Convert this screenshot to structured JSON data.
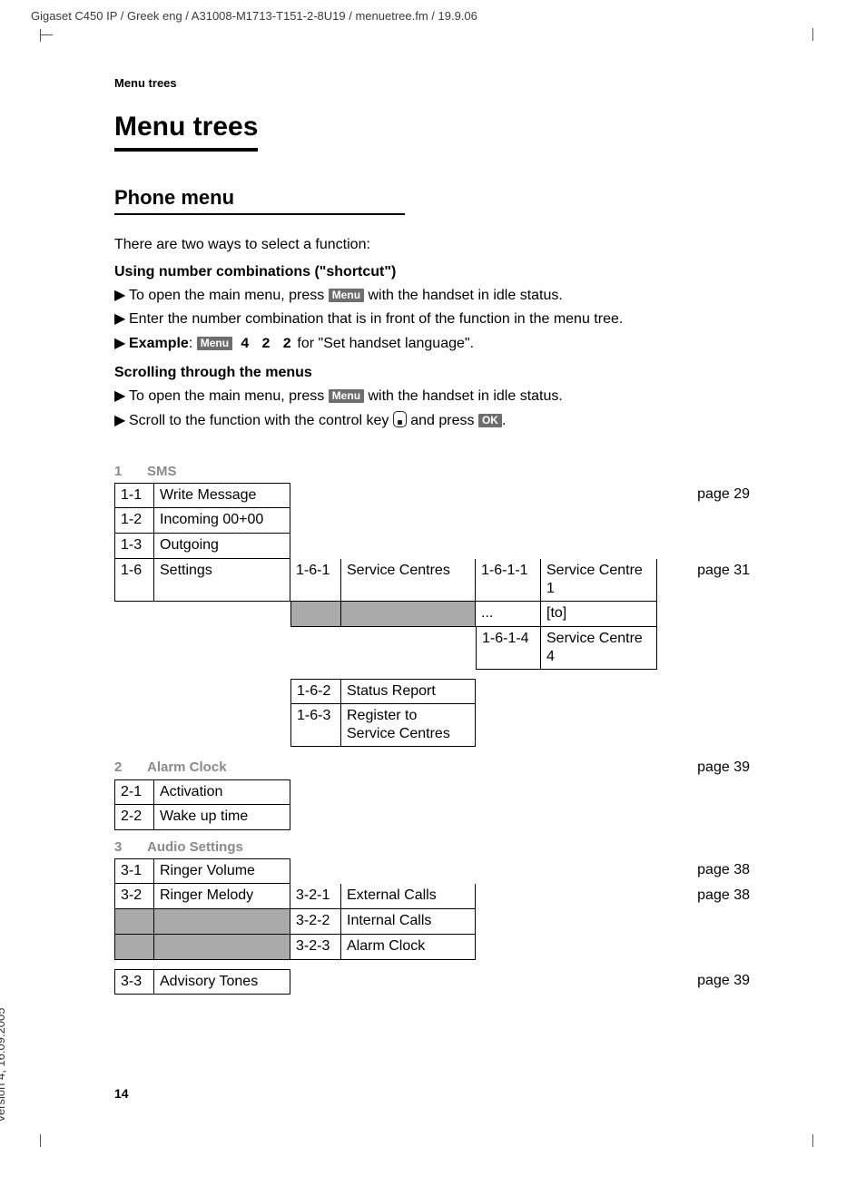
{
  "header_line": "Gigaset C450 IP / Greek eng / A31008-M1713-T151-2-8U19 / menuetree.fm / 19.9.06",
  "running_head": "Menu trees",
  "title": "Menu trees",
  "subtitle": "Phone menu",
  "intro": "There are two ways to select a function:",
  "section1": {
    "head": "Using number combinations (\"shortcut\")",
    "b1a": "To open the main menu, press ",
    "menu_key": "Menu",
    "b1b": " with the handset in idle status.",
    "b2": "Enter the number combination that is in front of the function in the menu tree.",
    "b3_label": "Example",
    "b3_code": "4 2 2",
    "b3_tail": " for \"Set handset language\"."
  },
  "section2": {
    "head": "Scrolling through the menus",
    "b1a": "To open the main menu, press ",
    "menu_key": "Menu",
    "b1b": " with the handset in idle status.",
    "b2a": "Scroll to the function with the control key ",
    "b2b": " and press ",
    "ok_key": "OK",
    "b2c": "."
  },
  "tree": {
    "s1": {
      "num": "1",
      "title": "SMS"
    },
    "s1_rows": [
      {
        "code": "1-1",
        "name": "Write Message",
        "page": "page 29"
      },
      {
        "code": "1-2",
        "name": "Incoming 00+00"
      },
      {
        "code": "1-3",
        "name": "Outgoing"
      },
      {
        "code": "1-6",
        "name": "Settings",
        "l2": [
          {
            "code": "1-6-1",
            "name": "Service Centres",
            "l3": [
              {
                "code": "1-6-1-1",
                "name": "Service Centre 1",
                "page": "page 31"
              },
              {
                "code": "...",
                "name": "[to]"
              },
              {
                "code": "1-6-1-4",
                "name": "Service Centre 4"
              }
            ]
          },
          {
            "code": "1-6-2",
            "name": "Status Report"
          },
          {
            "code": "1-6-3",
            "name": "Register to Service Centres"
          }
        ]
      }
    ],
    "s2": {
      "num": "2",
      "title": "Alarm Clock",
      "page": "page 39"
    },
    "s2_rows": [
      {
        "code": "2-1",
        "name": "Activation"
      },
      {
        "code": "2-2",
        "name": "Wake up time"
      }
    ],
    "s3": {
      "num": "3",
      "title": "Audio Settings"
    },
    "s3_rows": [
      {
        "code": "3-1",
        "name": "Ringer Volume",
        "page": "page 38"
      },
      {
        "code": "3-2",
        "name": "Ringer Melody",
        "l2": [
          {
            "code": "3-2-1",
            "name": "External Calls",
            "page": "page 38"
          },
          {
            "code": "3-2-2",
            "name": "Internal Calls"
          },
          {
            "code": "3-2-3",
            "name": "Alarm Clock"
          }
        ]
      },
      {
        "code": "3-3",
        "name": "Advisory Tones",
        "page": "page 39"
      }
    ]
  },
  "page_number": "14",
  "side_text": "Version 4, 16.09.2005"
}
